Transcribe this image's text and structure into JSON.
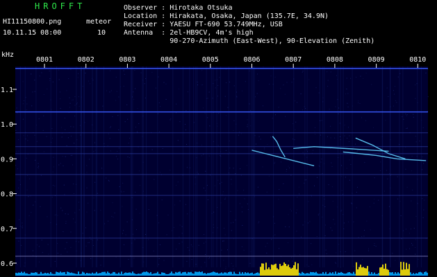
{
  "header": {
    "app_name": "HROFFT",
    "filename": "HI11150800.png",
    "datetime": "10.11.15 08:00",
    "meteor_label": "meteor",
    "meteor_count": "10",
    "info_lines": [
      "Observer : Hirotaka Otsuka",
      "Location : Hirakata, Osaka, Japan (135.7E, 34.9N)",
      "Receiver : YAESU FT-690 53.749MHz, USB",
      "Antenna  : 2el-HB9CV, 4m's high",
      "           90-270-Azimuth (East-West), 90-Elevation (Zenith)"
    ]
  },
  "chart_data": {
    "type": "spectrogram",
    "y_unit": "kHz",
    "y_ticks": [
      "1.1",
      "1.0",
      "0.9",
      "0.8",
      "0.7",
      "0.6"
    ],
    "x_ticks": [
      "0801",
      "0802",
      "0803",
      "0804",
      "0805",
      "0806",
      "0807",
      "0808",
      "0809",
      "0810"
    ],
    "background_color": "#000030",
    "signal_color": "#5fd0ff",
    "activity_color": "#f5e10a",
    "carrier_lines_khz": [
      1.16,
      1.035,
      0.975,
      0.935,
      0.915,
      0.855,
      0.795,
      0.672,
      0.62
    ],
    "meteor_traces": [
      {
        "points": [
          [
            8065,
            0.965
          ],
          [
            8066,
            0.95
          ],
          [
            8067,
            0.925
          ],
          [
            8068,
            0.905
          ]
        ]
      },
      {
        "points": [
          [
            8060,
            0.925
          ],
          [
            8065,
            0.91
          ],
          [
            8070,
            0.895
          ],
          [
            8075,
            0.88
          ]
        ]
      },
      {
        "points": [
          [
            8070,
            0.93
          ],
          [
            8075,
            0.935
          ],
          [
            8085,
            0.928
          ],
          [
            8093,
            0.922
          ]
        ]
      },
      {
        "points": [
          [
            8085,
            0.96
          ],
          [
            8089,
            0.94
          ],
          [
            8093,
            0.915
          ],
          [
            8097,
            0.9
          ]
        ]
      },
      {
        "points": [
          [
            8082,
            0.92
          ],
          [
            8090,
            0.91
          ],
          [
            8095,
            0.9
          ],
          [
            8102,
            0.895
          ]
        ]
      }
    ]
  }
}
